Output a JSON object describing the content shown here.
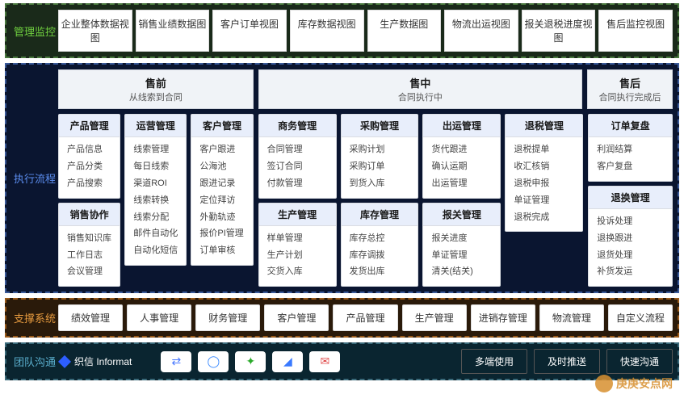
{
  "section1": {
    "label": "管理监控",
    "views": [
      "企业整体数据视图",
      "销售业绩数据图",
      "客户订单视图",
      "库存数据视图",
      "生产数据图",
      "物流出运视图",
      "报关退税进度视图",
      "售后监控视图"
    ]
  },
  "section2": {
    "label": "执行流程",
    "stages": [
      {
        "title": "售前",
        "sub": "从线索到合同"
      },
      {
        "title": "售中",
        "sub": "合同执行中"
      },
      {
        "title": "售后",
        "sub": "合同执行完成后"
      }
    ],
    "presale": {
      "col1": [
        {
          "header": "产品管理",
          "items": [
            "产品信息",
            "产品分类",
            "产品搜索"
          ]
        },
        {
          "header": "销售协作",
          "items": [
            "销售知识库",
            "工作日志",
            "会议管理"
          ]
        }
      ],
      "col2": [
        {
          "header": "运营管理",
          "items": [
            "线索管理",
            "每日线索",
            "渠道ROI",
            "线索转换",
            "线索分配",
            "邮件自动化",
            "自动化短信"
          ]
        }
      ],
      "col3": [
        {
          "header": "客户管理",
          "items": [
            "客户跟进",
            "公海池",
            "跟进记录",
            "定位拜访",
            "外勤轨迹",
            "报价PI管理",
            "订单审核"
          ]
        }
      ]
    },
    "insale": {
      "col1": [
        {
          "header": "商务管理",
          "items": [
            "合同管理",
            "签订合同",
            "付款管理"
          ]
        },
        {
          "header": "生产管理",
          "items": [
            "样单管理",
            "生产计划",
            "交货入库"
          ]
        }
      ],
      "col2": [
        {
          "header": "采购管理",
          "items": [
            "采购计划",
            "采购订单",
            "到货入库"
          ]
        },
        {
          "header": "库存管理",
          "items": [
            "库存总控",
            "库存调拨",
            "发货出库"
          ]
        }
      ],
      "col3": [
        {
          "header": "出运管理",
          "items": [
            "货代跟进",
            "确认运期",
            "出运管理"
          ]
        },
        {
          "header": "报关管理",
          "items": [
            "报关进度",
            "单证管理",
            "清关(结关)"
          ]
        }
      ],
      "col4": [
        {
          "header": "退税管理",
          "items": [
            "退税提单",
            "收汇核销",
            "退税申报",
            "单证管理",
            "退税完成"
          ]
        }
      ]
    },
    "postsale": [
      {
        "header": "订单复盘",
        "items": [
          "利润结算",
          "客户复盘"
        ]
      },
      {
        "header": "退换管理",
        "items": [
          "投诉处理",
          "退换跟进",
          "退货处理",
          "补货发运"
        ]
      }
    ]
  },
  "section3": {
    "label": "支撑系统",
    "items": [
      "绩效管理",
      "人事管理",
      "财务管理",
      "客户管理",
      "产品管理",
      "生产管理",
      "进销存管理",
      "物流管理",
      "自定义流程"
    ]
  },
  "section4": {
    "label": "团队沟通",
    "brand": "织信 Informat",
    "icons": {
      "swap": {
        "glyph": "⇄",
        "color": "#4a7aff"
      },
      "chat": {
        "glyph": "◯",
        "color": "#3a8aff"
      },
      "wechat": {
        "glyph": "✦",
        "color": "#2aaa2a"
      },
      "dingtalk": {
        "glyph": "◢",
        "color": "#3a7aff"
      },
      "mail": {
        "glyph": "✉",
        "color": "#e04a4a"
      }
    },
    "buttons": [
      "多端使用",
      "及时推送",
      "快速沟通"
    ]
  },
  "watermark": "庚庚安点网"
}
